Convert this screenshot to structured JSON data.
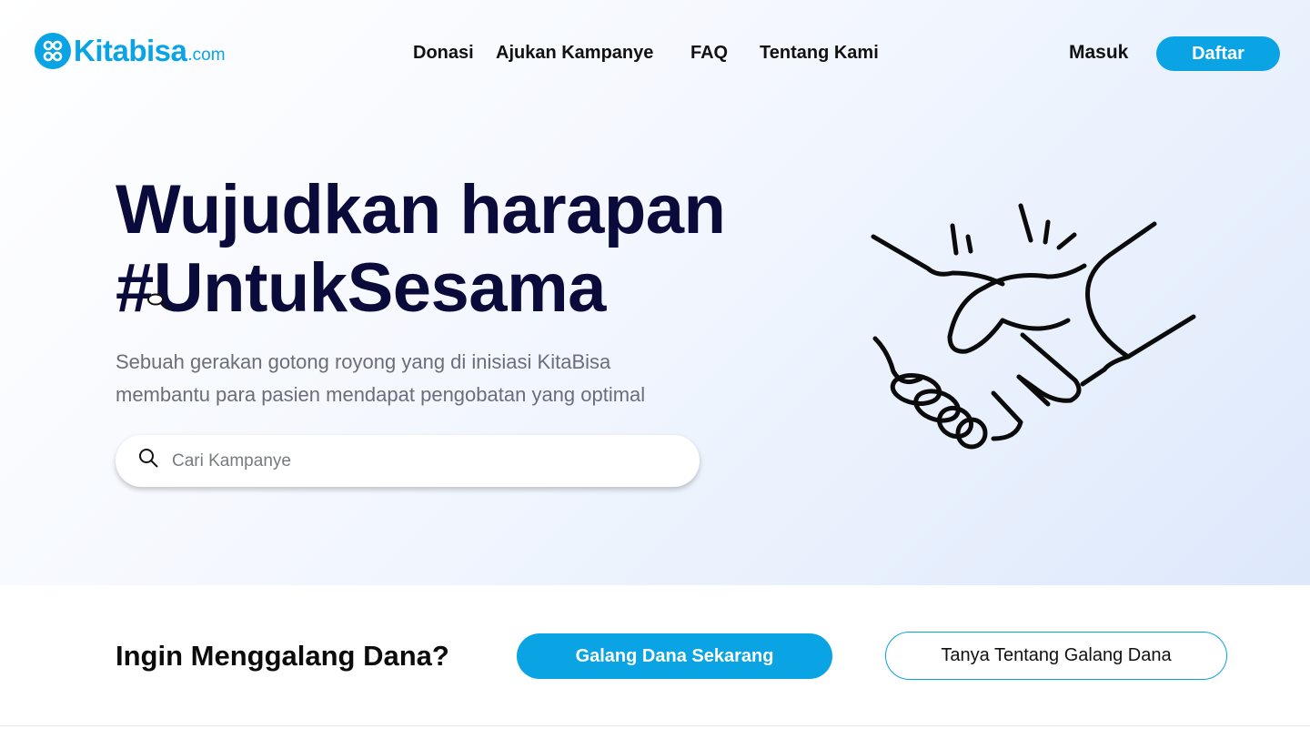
{
  "brand": {
    "name": "Kitabisa",
    "suffix": ".com",
    "color": "#0aa3e4"
  },
  "nav": {
    "items": [
      "Donasi",
      "Ajukan Kampanye",
      "FAQ",
      "Tentang Kami"
    ]
  },
  "auth": {
    "login_label": "Masuk",
    "register_label": "Daftar"
  },
  "hero": {
    "headline_line1": "Wujudkan harapan",
    "headline_line2": "#UntukSesama",
    "subtitle_line1": "Sebuah gerakan gotong royong yang di inisiasi KitaBisa",
    "subtitle_line2": "membantu para pasien mendapat pengobatan yang optimal",
    "illustration_icon": "handshake-icon"
  },
  "search": {
    "placeholder": "Cari Kampanye",
    "value": "",
    "icon": "search-icon"
  },
  "cta": {
    "title": "Ingin Menggalang Dana?",
    "primary_label": "Galang Dana Sekarang",
    "secondary_label": "Tanya Tentang Galang Dana"
  },
  "colors": {
    "accent": "#0aa3e4",
    "headline": "#0b0b3b",
    "subtitle": "#6b6e7a"
  }
}
